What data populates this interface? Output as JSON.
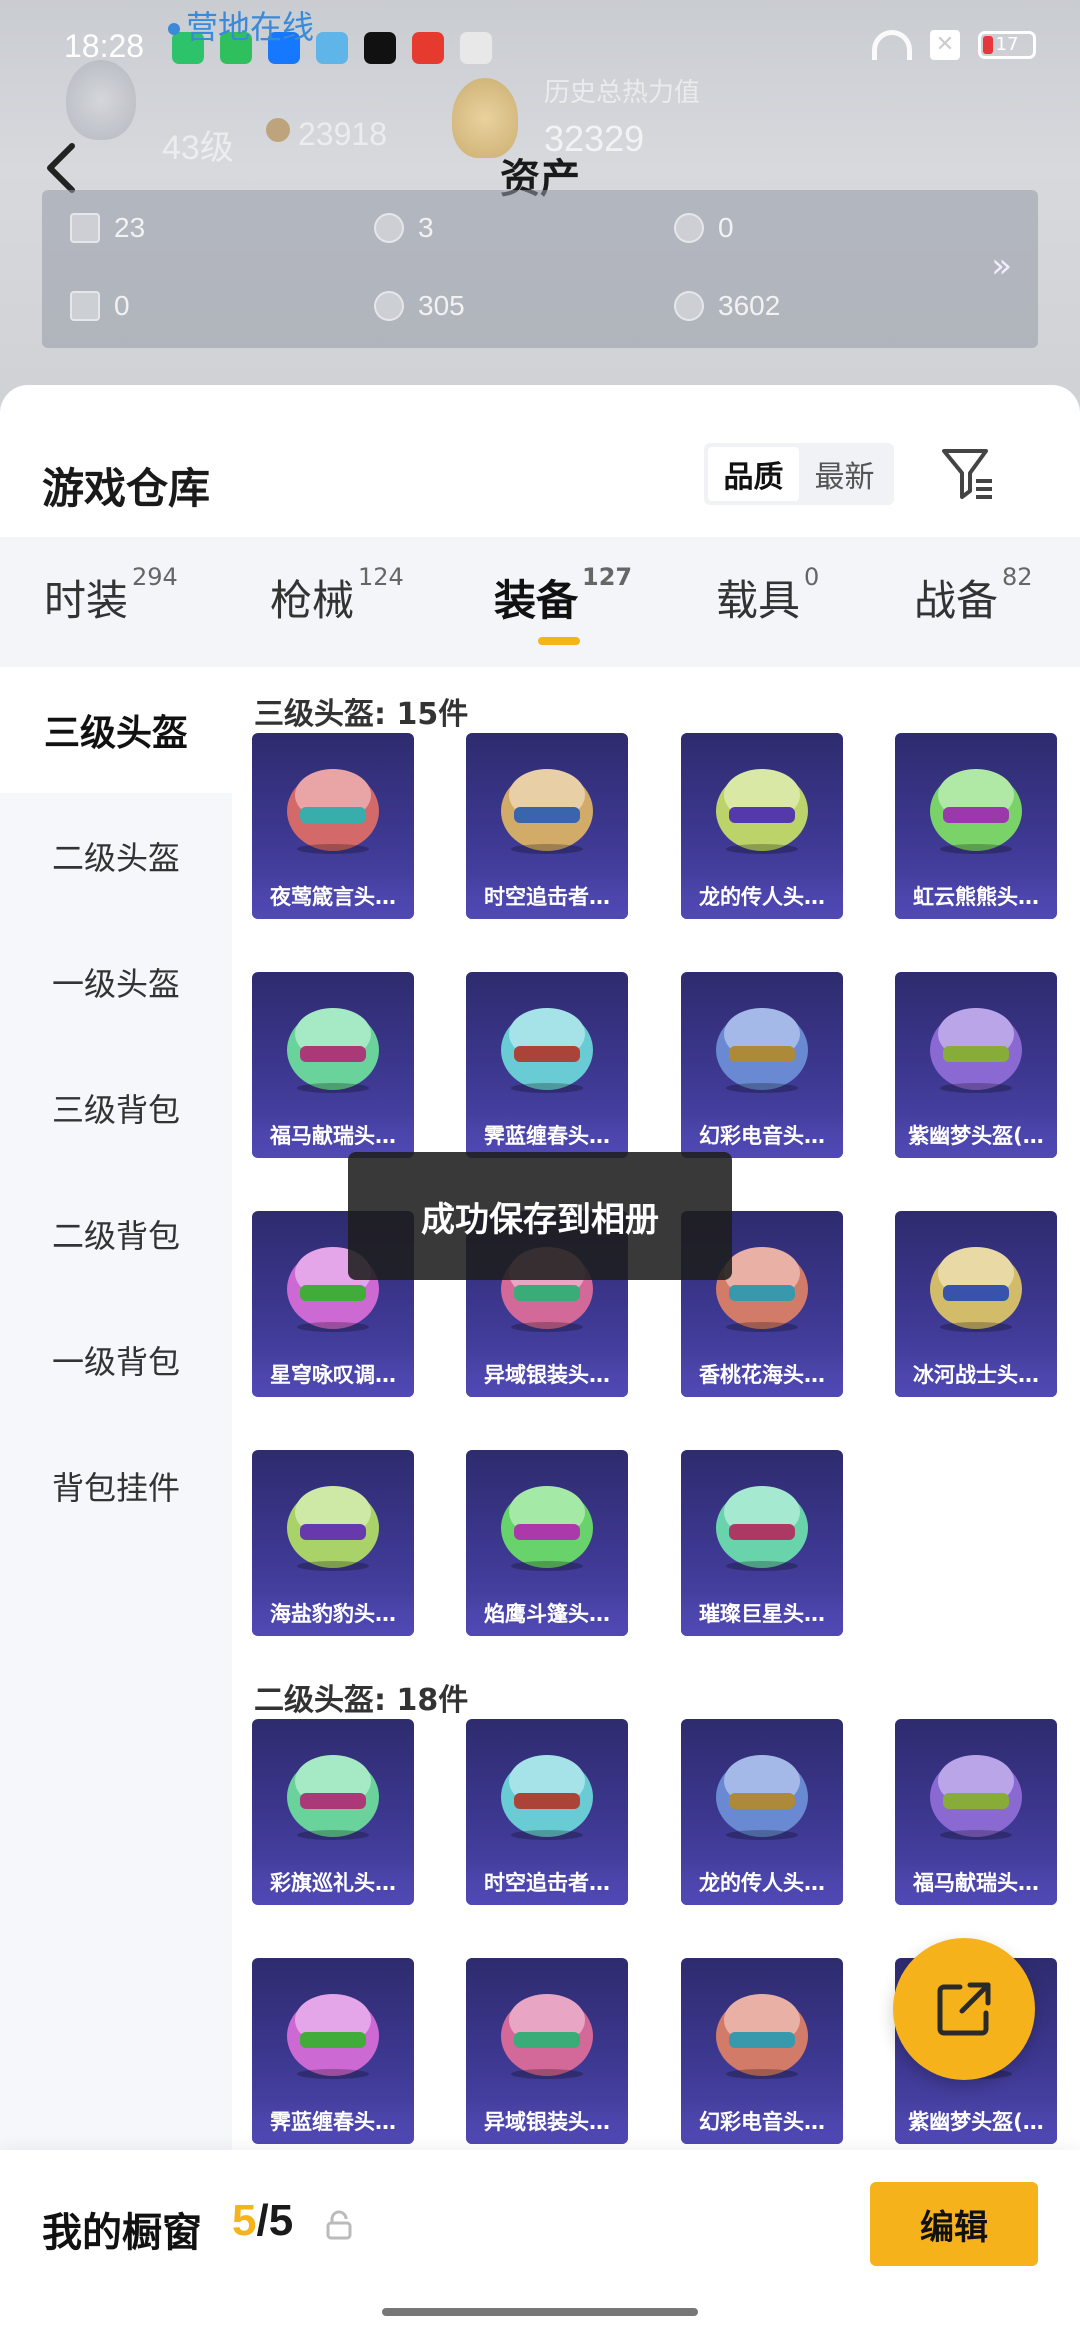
{
  "status_bar": {
    "time": "18:28",
    "battery": "17"
  },
  "overlay": {
    "camp_online": "营地在线"
  },
  "header": {
    "title": "资产",
    "ghost_level": "43级",
    "ghost_points": "23918",
    "ghost_heat_label": "历史总热力值",
    "ghost_heat_value": "32329"
  },
  "assets": {
    "items": [
      {
        "value": "23"
      },
      {
        "value": "3"
      },
      {
        "value": "0"
      },
      {
        "value": "0"
      },
      {
        "value": "305"
      },
      {
        "value": "3602"
      }
    ],
    "more": "»"
  },
  "warehouse": {
    "title": "游戏仓库",
    "sort_options": [
      "品质",
      "最新"
    ],
    "categories": [
      {
        "label": "时装",
        "count": "294"
      },
      {
        "label": "枪械",
        "count": "124"
      },
      {
        "label": "装备",
        "count": "127"
      },
      {
        "label": "载具",
        "count": "0"
      },
      {
        "label": "战备",
        "count": "82"
      }
    ],
    "sidebar": [
      "三级头盔",
      "二级头盔",
      "一级头盔",
      "三级背包",
      "二级背包",
      "一级背包",
      "背包挂件"
    ],
    "sections": [
      {
        "title": "三级头盔: 15件",
        "items": [
          "夜莺箴言头…",
          "时空追击者…",
          "龙的传人头…",
          "虹云熊熊头…",
          "福马献瑞头…",
          "霁蓝缠春头…",
          "幻彩电音头…",
          "紫幽梦头盔(…",
          "星穹咏叹调…",
          "异域银装头…",
          "香桃花海头…",
          "冰河战士头…",
          "海盐豹豹头…",
          "焰鹰斗篷头…",
          "璀璨巨星头…"
        ]
      },
      {
        "title": "二级头盔: 18件",
        "items": [
          "彩旗巡礼头…",
          "时空追击者…",
          "龙的传人头…",
          "福马献瑞头…",
          "霁蓝缠春头…",
          "异域银装头…",
          "幻彩电音头…",
          "紫幽梦头盔(…"
        ]
      }
    ]
  },
  "toast": "成功保存到相册",
  "showcase": {
    "label": "我的橱窗",
    "current": "5",
    "total": "/5",
    "edit_label": "编辑"
  },
  "colors": {
    "accent": "#f6b21b",
    "card_purple": "#3d3891",
    "toast_bg": "#1e1e1e"
  }
}
